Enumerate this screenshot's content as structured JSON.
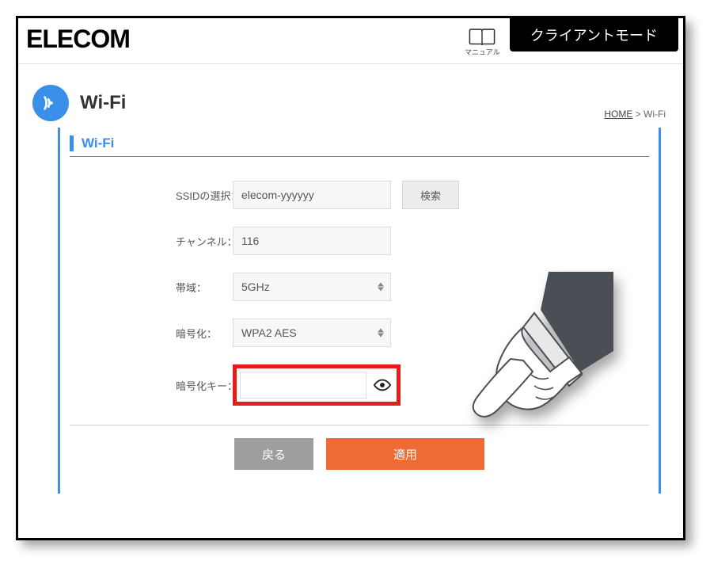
{
  "header": {
    "logo": "ELECOM",
    "manual_label": "マニュアル",
    "mode_label": "クライアントモード"
  },
  "breadcrumb": {
    "home": "HOME",
    "sep": " > ",
    "current": "Wi-Fi"
  },
  "page": {
    "title": "Wi-Fi",
    "section_title": "Wi-Fi"
  },
  "form": {
    "ssid_label": "SSIDの選択：",
    "ssid_value": "elecom-yyyyyy",
    "search_label": "検索",
    "channel_label": "チャンネル：",
    "channel_value": "116",
    "band_label": "帯域：",
    "band_value": "5GHz",
    "encryption_label": "暗号化：",
    "encryption_value": "WPA2 AES",
    "key_label": "暗号化キー：",
    "key_value": ""
  },
  "buttons": {
    "back": "戻る",
    "apply": "適用"
  }
}
